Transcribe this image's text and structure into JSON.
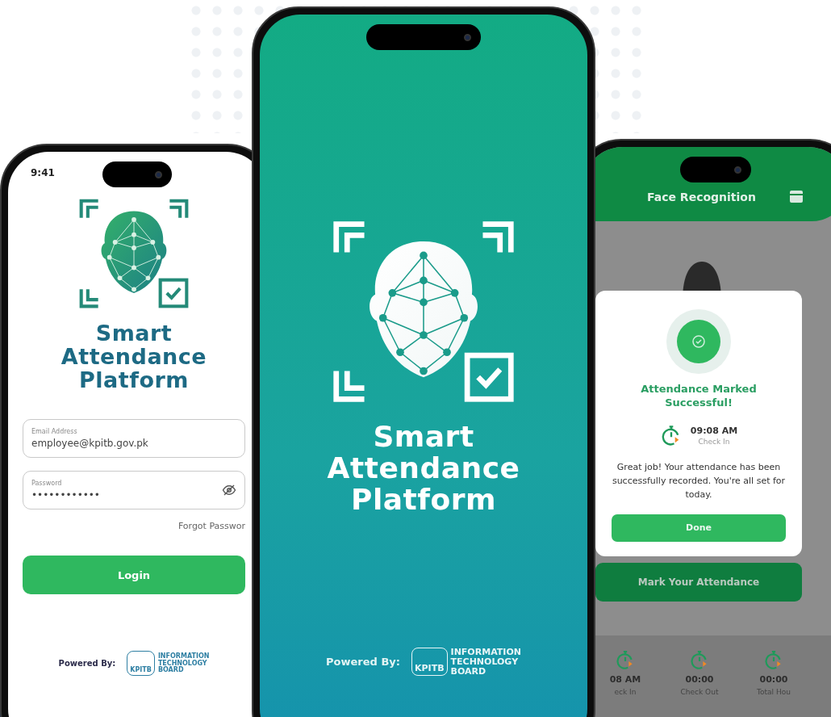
{
  "login_screen": {
    "status_time": "9:41",
    "app_title": [
      "Smart",
      "Attendance",
      "Platform"
    ],
    "fields": [
      {
        "label": "Email Address",
        "value": "employee@kpitb.gov.pk",
        "masked": false
      },
      {
        "label": "Password",
        "value": "••••••••••••",
        "masked": true
      }
    ],
    "forgot_link": "Forgot Passwor",
    "login_button": "Login",
    "powered_by": "Powered By:",
    "org_badge": "KPITB",
    "org_name": [
      "INFORMATION",
      "TECHNOLOGY",
      "BOARD"
    ]
  },
  "splash_screen": {
    "app_title": [
      "Smart",
      "Attendance",
      "Platform"
    ],
    "powered_by": "Powered By:",
    "org_badge": "KPITB",
    "org_name": [
      "INFORMATION",
      "TECHNOLOGY",
      "BOARD"
    ]
  },
  "face_screen": {
    "header_title": "Face Recognition",
    "dialog": {
      "title": "Attendance Marked Successful!",
      "time": "09:08 AM",
      "time_label": "Check In",
      "message": "Great job! Your attendance has been successfully recorded. You're all set for today.",
      "button": "Done"
    },
    "action_button": "Mark Your Attendance",
    "stats": [
      {
        "value": "08 AM",
        "label": "eck In"
      },
      {
        "value": "00:00",
        "label": "Check Out"
      },
      {
        "value": "00:00",
        "label": "Total Hou"
      }
    ]
  }
}
